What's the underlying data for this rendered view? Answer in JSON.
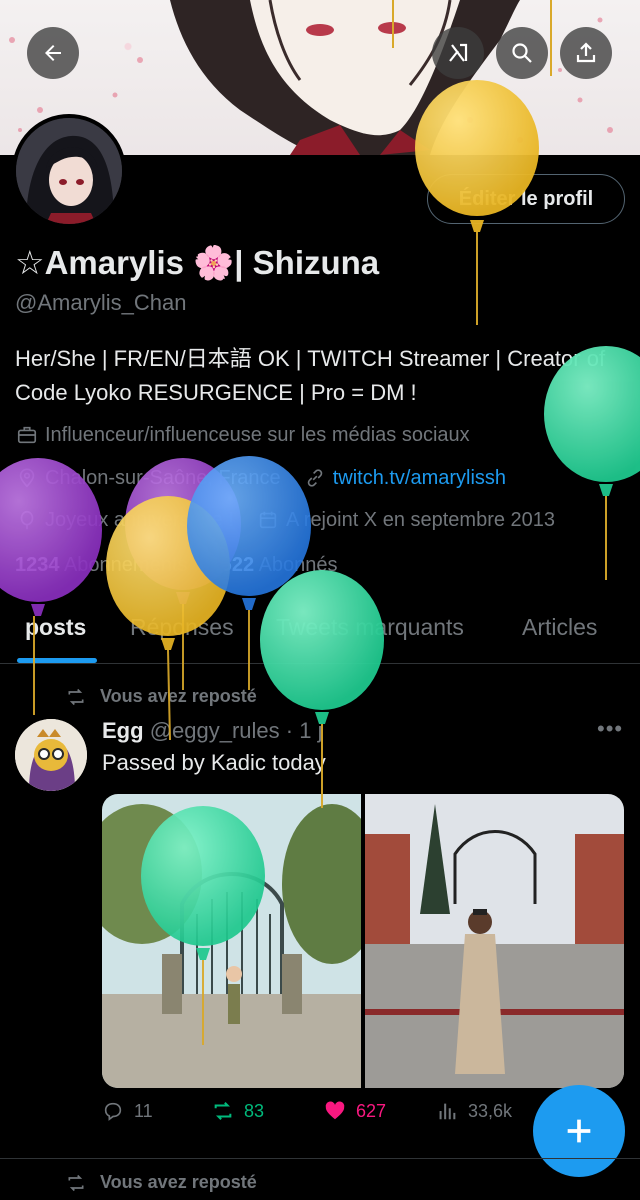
{
  "profile": {
    "edit_label": "Éditer le profil",
    "display_name": "☆Amarylis 🌸| Shizuna",
    "handle": "@Amarylis_Chan",
    "bio": "Her/She | FR/EN/日本語 OK | TWITCH Streamer | Creator of Code Lyoko RESURGENCE | Pro = DM !",
    "category": "Influenceur/influenceuse sur les médias sociaux",
    "location": "Chalon-sur-Saône, France",
    "website": "twitch.tv/amarylissh",
    "birthday": "Joyeux anniversaire !",
    "joined": "A rejoint X en septembre 2013",
    "following_count": "1234",
    "following_label": "Abonnements",
    "followers_count": "1622",
    "followers_label": "Abonnés"
  },
  "tabs": [
    {
      "label": "posts",
      "active": true
    },
    {
      "label": "Réponses",
      "active": false
    },
    {
      "label": "Tweets marquants",
      "active": false
    },
    {
      "label": "Articles",
      "active": false
    }
  ],
  "post": {
    "repost_label": "Vous avez reposté",
    "author": "Egg",
    "author_handle": "@eggy_rules",
    "time": "· 1 j",
    "text": "Passed by Kadic today",
    "replies": "11",
    "reposts": "83",
    "likes": "627",
    "views": "33,6k"
  },
  "next_post": {
    "repost_label": "Vous avez reposté"
  },
  "icons": {
    "back": "arrow-left-icon",
    "grok": "grok-icon",
    "search": "search-icon",
    "share": "share-icon",
    "compose": "plus-icon"
  },
  "colors": {
    "accent": "#1d9bf0",
    "retweet": "#00ba7c",
    "like": "#f91880",
    "muted": "#71767b",
    "balloon_yellow": "#f2c230",
    "balloon_green": "#2bd39a",
    "balloon_purple": "#9b3fc9",
    "balloon_blue": "#2f86e8"
  }
}
